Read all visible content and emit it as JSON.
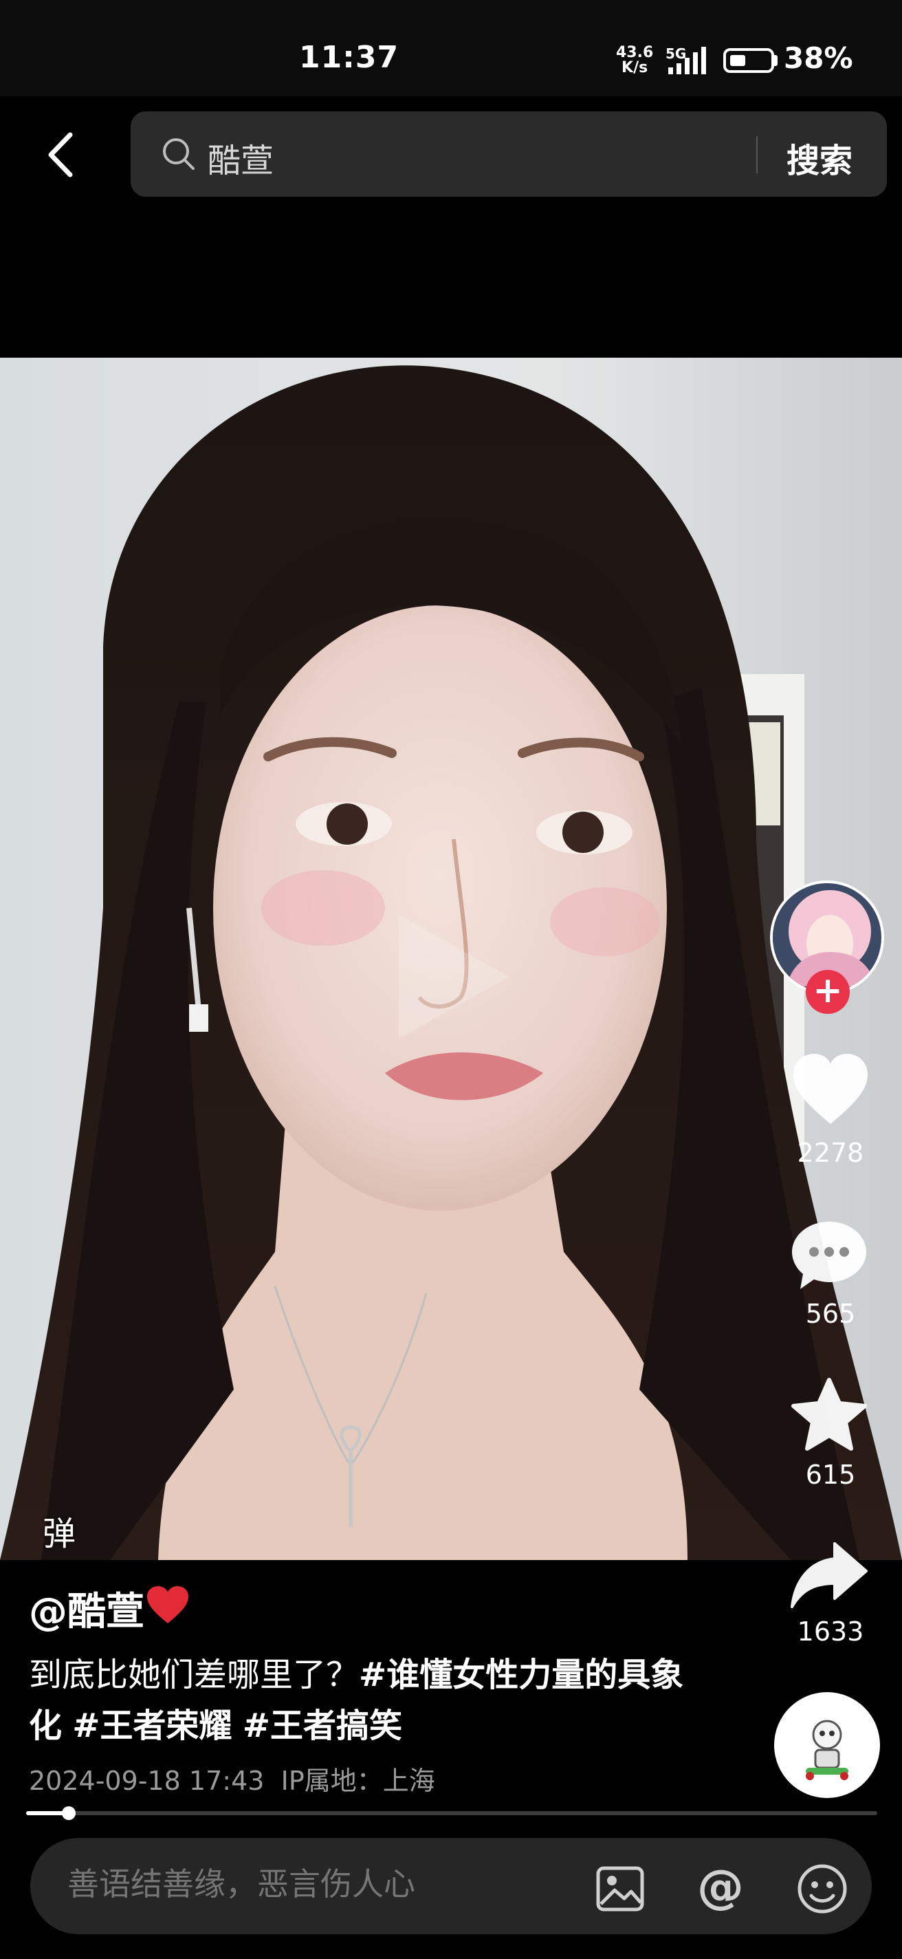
{
  "status_bar": {
    "time": "11:37",
    "net_speed_value": "43.6",
    "net_speed_unit": "K/s",
    "network": "5G",
    "battery": "38%",
    "battery_level": 0.38
  },
  "header": {
    "search_query": "酷萱",
    "search_button": "搜索"
  },
  "video": {
    "danmaku_toggle": "弹",
    "author": "@酷萱",
    "caption_text": "到底比她们差哪里了？",
    "hashtags": [
      "#谁懂女性力量的具象化",
      "#王者荣耀",
      "#王者搞笑"
    ],
    "date": "2024-09-18 17:43",
    "ip_location": "IP属地：上海",
    "progress": 0.05
  },
  "actions": {
    "likes": "2278",
    "comments": "565",
    "favorites": "615",
    "shares": "1633"
  },
  "comment_bar": {
    "placeholder": "善语结善缘，恶言伤人心"
  },
  "icons": [
    "back-arrow-icon",
    "search-icon",
    "play-icon",
    "heart-icon",
    "comment-icon",
    "star-icon",
    "share-icon",
    "image-icon",
    "at-icon",
    "emoji-icon",
    "plus-icon"
  ],
  "colors": {
    "accent_red": "#e8334b",
    "background": "#000000",
    "search_bg": "#2b2b2b"
  }
}
